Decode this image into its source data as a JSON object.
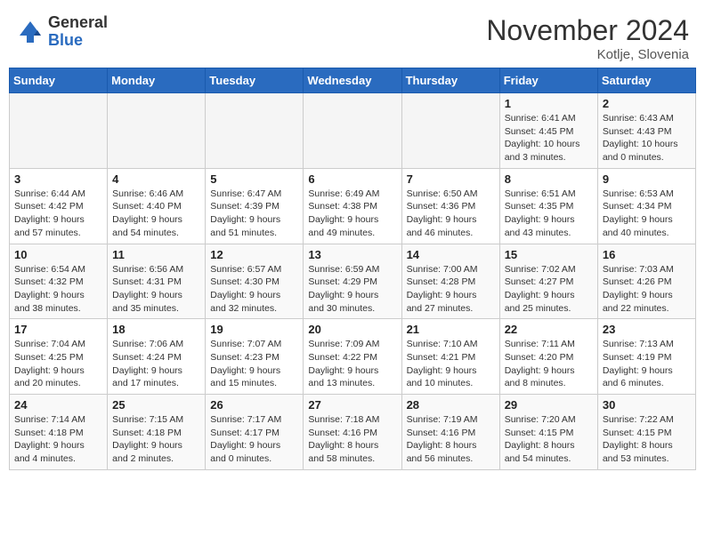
{
  "header": {
    "logo_general": "General",
    "logo_blue": "Blue",
    "month_title": "November 2024",
    "location": "Kotlje, Slovenia"
  },
  "weekdays": [
    "Sunday",
    "Monday",
    "Tuesday",
    "Wednesday",
    "Thursday",
    "Friday",
    "Saturday"
  ],
  "weeks": [
    [
      {
        "day": "",
        "info": ""
      },
      {
        "day": "",
        "info": ""
      },
      {
        "day": "",
        "info": ""
      },
      {
        "day": "",
        "info": ""
      },
      {
        "day": "",
        "info": ""
      },
      {
        "day": "1",
        "info": "Sunrise: 6:41 AM\nSunset: 4:45 PM\nDaylight: 10 hours\nand 3 minutes."
      },
      {
        "day": "2",
        "info": "Sunrise: 6:43 AM\nSunset: 4:43 PM\nDaylight: 10 hours\nand 0 minutes."
      }
    ],
    [
      {
        "day": "3",
        "info": "Sunrise: 6:44 AM\nSunset: 4:42 PM\nDaylight: 9 hours\nand 57 minutes."
      },
      {
        "day": "4",
        "info": "Sunrise: 6:46 AM\nSunset: 4:40 PM\nDaylight: 9 hours\nand 54 minutes."
      },
      {
        "day": "5",
        "info": "Sunrise: 6:47 AM\nSunset: 4:39 PM\nDaylight: 9 hours\nand 51 minutes."
      },
      {
        "day": "6",
        "info": "Sunrise: 6:49 AM\nSunset: 4:38 PM\nDaylight: 9 hours\nand 49 minutes."
      },
      {
        "day": "7",
        "info": "Sunrise: 6:50 AM\nSunset: 4:36 PM\nDaylight: 9 hours\nand 46 minutes."
      },
      {
        "day": "8",
        "info": "Sunrise: 6:51 AM\nSunset: 4:35 PM\nDaylight: 9 hours\nand 43 minutes."
      },
      {
        "day": "9",
        "info": "Sunrise: 6:53 AM\nSunset: 4:34 PM\nDaylight: 9 hours\nand 40 minutes."
      }
    ],
    [
      {
        "day": "10",
        "info": "Sunrise: 6:54 AM\nSunset: 4:32 PM\nDaylight: 9 hours\nand 38 minutes."
      },
      {
        "day": "11",
        "info": "Sunrise: 6:56 AM\nSunset: 4:31 PM\nDaylight: 9 hours\nand 35 minutes."
      },
      {
        "day": "12",
        "info": "Sunrise: 6:57 AM\nSunset: 4:30 PM\nDaylight: 9 hours\nand 32 minutes."
      },
      {
        "day": "13",
        "info": "Sunrise: 6:59 AM\nSunset: 4:29 PM\nDaylight: 9 hours\nand 30 minutes."
      },
      {
        "day": "14",
        "info": "Sunrise: 7:00 AM\nSunset: 4:28 PM\nDaylight: 9 hours\nand 27 minutes."
      },
      {
        "day": "15",
        "info": "Sunrise: 7:02 AM\nSunset: 4:27 PM\nDaylight: 9 hours\nand 25 minutes."
      },
      {
        "day": "16",
        "info": "Sunrise: 7:03 AM\nSunset: 4:26 PM\nDaylight: 9 hours\nand 22 minutes."
      }
    ],
    [
      {
        "day": "17",
        "info": "Sunrise: 7:04 AM\nSunset: 4:25 PM\nDaylight: 9 hours\nand 20 minutes."
      },
      {
        "day": "18",
        "info": "Sunrise: 7:06 AM\nSunset: 4:24 PM\nDaylight: 9 hours\nand 17 minutes."
      },
      {
        "day": "19",
        "info": "Sunrise: 7:07 AM\nSunset: 4:23 PM\nDaylight: 9 hours\nand 15 minutes."
      },
      {
        "day": "20",
        "info": "Sunrise: 7:09 AM\nSunset: 4:22 PM\nDaylight: 9 hours\nand 13 minutes."
      },
      {
        "day": "21",
        "info": "Sunrise: 7:10 AM\nSunset: 4:21 PM\nDaylight: 9 hours\nand 10 minutes."
      },
      {
        "day": "22",
        "info": "Sunrise: 7:11 AM\nSunset: 4:20 PM\nDaylight: 9 hours\nand 8 minutes."
      },
      {
        "day": "23",
        "info": "Sunrise: 7:13 AM\nSunset: 4:19 PM\nDaylight: 9 hours\nand 6 minutes."
      }
    ],
    [
      {
        "day": "24",
        "info": "Sunrise: 7:14 AM\nSunset: 4:18 PM\nDaylight: 9 hours\nand 4 minutes."
      },
      {
        "day": "25",
        "info": "Sunrise: 7:15 AM\nSunset: 4:18 PM\nDaylight: 9 hours\nand 2 minutes."
      },
      {
        "day": "26",
        "info": "Sunrise: 7:17 AM\nSunset: 4:17 PM\nDaylight: 9 hours\nand 0 minutes."
      },
      {
        "day": "27",
        "info": "Sunrise: 7:18 AM\nSunset: 4:16 PM\nDaylight: 8 hours\nand 58 minutes."
      },
      {
        "day": "28",
        "info": "Sunrise: 7:19 AM\nSunset: 4:16 PM\nDaylight: 8 hours\nand 56 minutes."
      },
      {
        "day": "29",
        "info": "Sunrise: 7:20 AM\nSunset: 4:15 PM\nDaylight: 8 hours\nand 54 minutes."
      },
      {
        "day": "30",
        "info": "Sunrise: 7:22 AM\nSunset: 4:15 PM\nDaylight: 8 hours\nand 53 minutes."
      }
    ]
  ]
}
